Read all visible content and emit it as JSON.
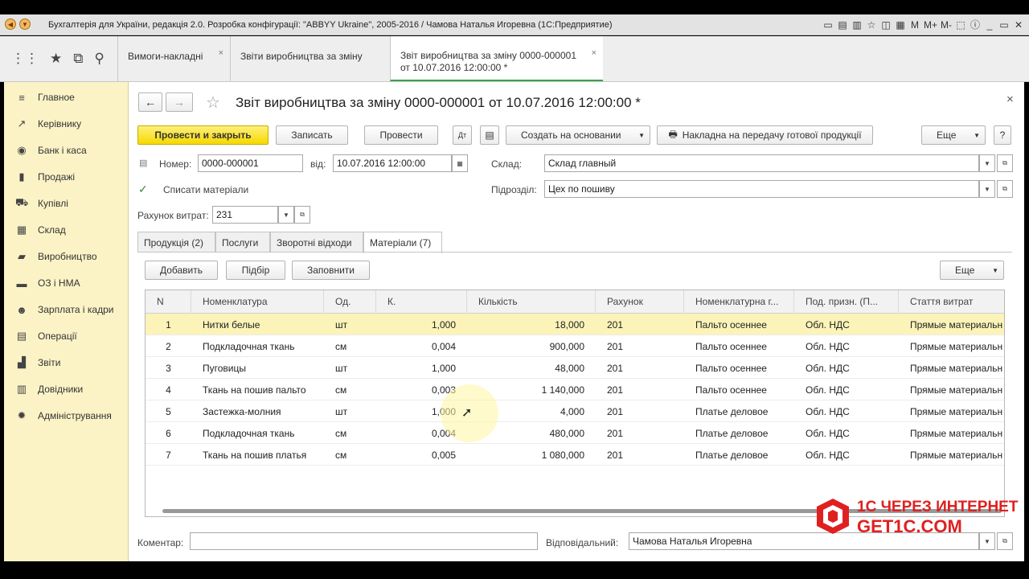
{
  "window": {
    "title": "Бухгалтерія для України, редакція 2.0. Розробка конфігурації: \"ABBYY Ukraine\", 2005-2016 / Чамова Наталья Игоревна  (1С:Предприятие)",
    "tools": [
      "▭",
      "▤",
      "▥",
      "☆",
      "◫",
      "▦",
      "M",
      "M+",
      "M-",
      "⬚",
      "ⓘ",
      "_",
      "▭",
      "✕"
    ]
  },
  "tabs": [
    {
      "label": "Вимоги-накладні"
    },
    {
      "label": "Звіти виробництва за зміну"
    },
    {
      "label": "Звіт виробництва за зміну 0000-000001 от 10.07.2016 12:00:00 *"
    }
  ],
  "sidebar": {
    "items": [
      {
        "label": "Главное",
        "icon": "≡"
      },
      {
        "label": "Керівнику",
        "icon": "↗"
      },
      {
        "label": "Банк і каса",
        "icon": "◉"
      },
      {
        "label": "Продажі",
        "icon": "▮"
      },
      {
        "label": "Купівлі",
        "icon": "⛟"
      },
      {
        "label": "Склад",
        "icon": "▦"
      },
      {
        "label": "Виробництво",
        "icon": "▰"
      },
      {
        "label": "ОЗ і НМА",
        "icon": "▬"
      },
      {
        "label": "Зарплата і кадри",
        "icon": "☻"
      },
      {
        "label": "Операції",
        "icon": "▤"
      },
      {
        "label": "Звіти",
        "icon": "▟"
      },
      {
        "label": "Довідники",
        "icon": "▥"
      },
      {
        "label": "Адміністрування",
        "icon": "✹"
      }
    ]
  },
  "doc": {
    "title": "Звіт виробництва за зміну 0000-000001 от 10.07.2016 12:00:00 *",
    "buttons": {
      "post_close": "Провести и закрыть",
      "save": "Записать",
      "post": "Провести",
      "create_based": "Создать на основании",
      "waybill": "Накладна на передачу готової продукції",
      "more": "Еще",
      "help": "?"
    },
    "number_label": "Номер:",
    "number": "0000-000001",
    "date_label": "від:",
    "date": "10.07.2016 12:00:00",
    "warehouse_label": "Склад:",
    "warehouse": "Склад главный",
    "writeoff_label": "Списати  матеріали",
    "division_label": "Підрозділ:",
    "division": "Цех по пошиву",
    "cost_account_label": "Рахунок витрат:",
    "cost_account": "231",
    "comment_label": "Коментар:",
    "comment": "",
    "responsible_label": "Відповідальний:",
    "responsible": "Чамова Наталья Игоревна"
  },
  "page_tabs": [
    {
      "label": "Продукція (2)"
    },
    {
      "label": "Послуги"
    },
    {
      "label": "Зворотні відходи"
    },
    {
      "label": "Матеріали (7)"
    }
  ],
  "table_toolbar": {
    "add": "Добавить",
    "pick": "Підбір",
    "fill": "Заповнити",
    "more": "Еще"
  },
  "table": {
    "columns": [
      "N",
      "Номенклатура",
      "Од.",
      "К.",
      "Кількість",
      "Рахунок",
      "Номенклатурна г...",
      "Под. призн. (П...",
      "Стаття витрат"
    ],
    "rows": [
      [
        "1",
        "Нитки белые",
        "шт",
        "1,000",
        "18,000",
        "201",
        "Пальто осеннее",
        "Обл. НДС",
        "Прямые материальн"
      ],
      [
        "2",
        "Подкладочная ткань",
        "см",
        "0,004",
        "900,000",
        "201",
        "Пальто осеннее",
        "Обл. НДС",
        "Прямые материальн"
      ],
      [
        "3",
        "Пуговицы",
        "шт",
        "1,000",
        "48,000",
        "201",
        "Пальто осеннее",
        "Обл. НДС",
        "Прямые материальн"
      ],
      [
        "4",
        "Ткань на пошив пальто",
        "см",
        "0,003",
        "1 140,000",
        "201",
        "Пальто осеннее",
        "Обл. НДС",
        "Прямые материальн"
      ],
      [
        "5",
        "Застежка-молния",
        "шт",
        "1,000",
        "4,000",
        "201",
        "Платье деловое",
        "Обл. НДС",
        "Прямые материальн"
      ],
      [
        "6",
        "Подкладочная ткань",
        "см",
        "0,004",
        "480,000",
        "201",
        "Платье деловое",
        "Обл. НДС",
        "Прямые материальн"
      ],
      [
        "7",
        "Ткань на пошив платья",
        "см",
        "0,005",
        "1 080,000",
        "201",
        "Платье деловое",
        "Обл. НДС",
        "Прямые материальн"
      ]
    ]
  },
  "watermark": {
    "line1": "1С ЧЕРЕЗ ИНТЕРНЕТ",
    "line2": "GET1C.COM"
  },
  "colors": {
    "accent_yellow": "#f5d800",
    "sidebar_bg": "#fbf3c6",
    "selected_row": "#fbf3b8",
    "active_tab_line": "#3ca24a",
    "watermark": "#e02020"
  }
}
